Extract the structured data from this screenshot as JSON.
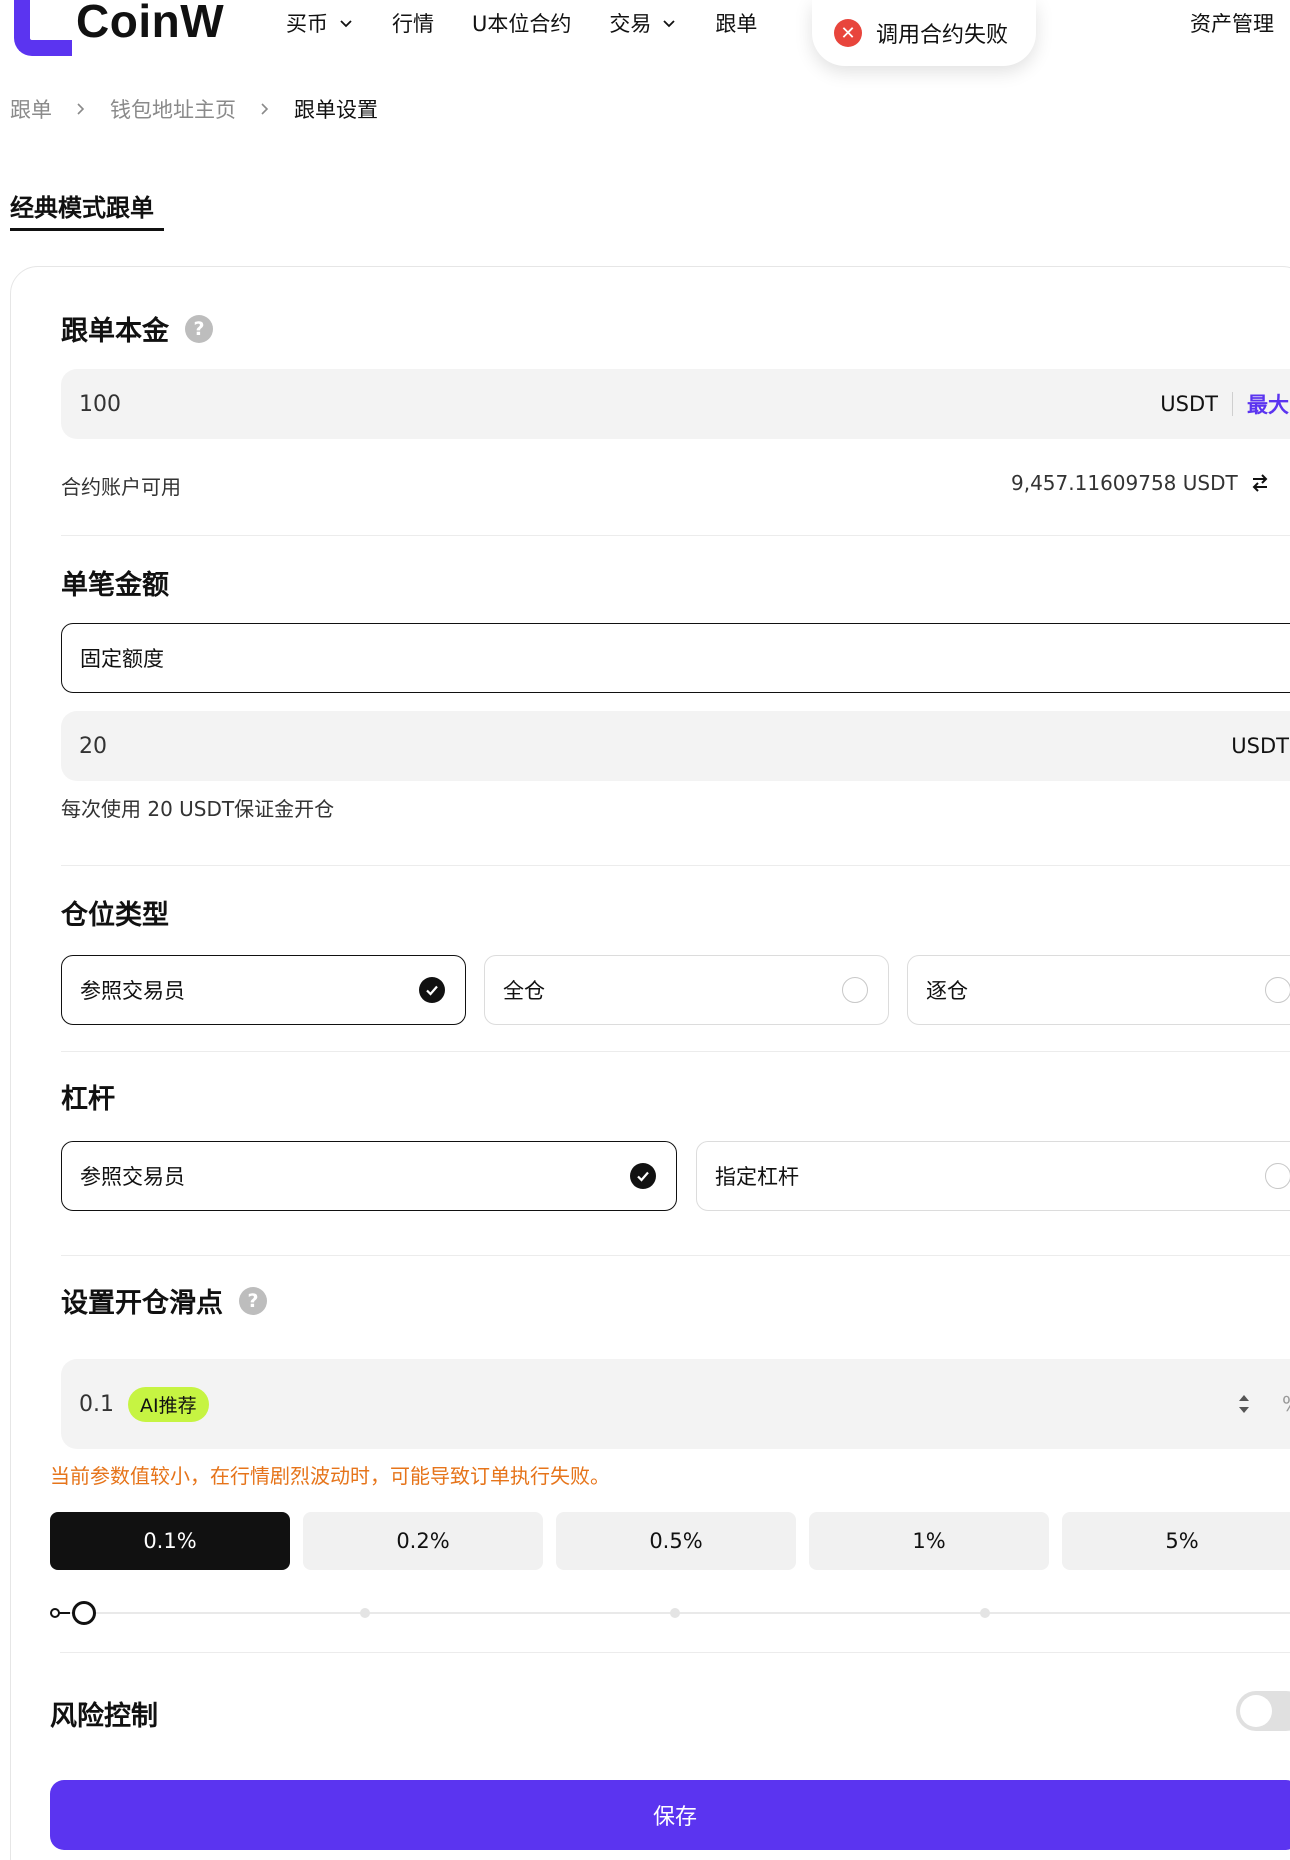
{
  "header": {
    "logo_text": "CoinW",
    "nav": [
      {
        "label": "买币",
        "has_dropdown": true
      },
      {
        "label": "行情",
        "has_dropdown": false
      },
      {
        "label": "U本位合约",
        "has_dropdown": false
      },
      {
        "label": "交易",
        "has_dropdown": true
      },
      {
        "label": "跟单",
        "has_dropdown": false
      }
    ],
    "right_link": "资产管理"
  },
  "toast": {
    "text": "调用合约失败",
    "icon": "error-x-icon"
  },
  "breadcrumb": [
    "跟单",
    "钱包地址主页",
    "跟单设置"
  ],
  "tab": {
    "label": "经典模式跟单"
  },
  "principal": {
    "title": "跟单本金",
    "value": "100",
    "unit": "USDT",
    "max_label": "最大",
    "available_label": "合约账户可用",
    "available_value": "9,457.11609758 USDT"
  },
  "single_amount": {
    "title": "单笔金额",
    "mode": "固定额度",
    "value": "20",
    "unit": "USDT",
    "hint": "每次使用 20 USDT保证金开仓"
  },
  "position_type": {
    "title": "仓位类型",
    "options": [
      "参照交易员",
      "全仓",
      "逐仓"
    ],
    "selected_index": 0
  },
  "leverage": {
    "title": "杠杆",
    "options": [
      "参照交易员",
      "指定杠杆"
    ],
    "selected_index": 0
  },
  "slippage": {
    "title": "设置开仓滑点",
    "value": "0.1",
    "ai_badge": "AI推荐",
    "unit": "%",
    "warning": "当前参数值较小，在行情剧烈波动时，可能导致订单执行失败。",
    "presets": [
      "0.1%",
      "0.2%",
      "0.5%",
      "1%",
      "5%"
    ],
    "active_preset": 0
  },
  "risk_control": {
    "title": "风险控制",
    "enabled": false
  },
  "save_label": "保存",
  "colors": {
    "brand": "#5b34f0",
    "ai_badge": "#c6f442",
    "warning": "#e6741a",
    "error": "#e8453c"
  }
}
